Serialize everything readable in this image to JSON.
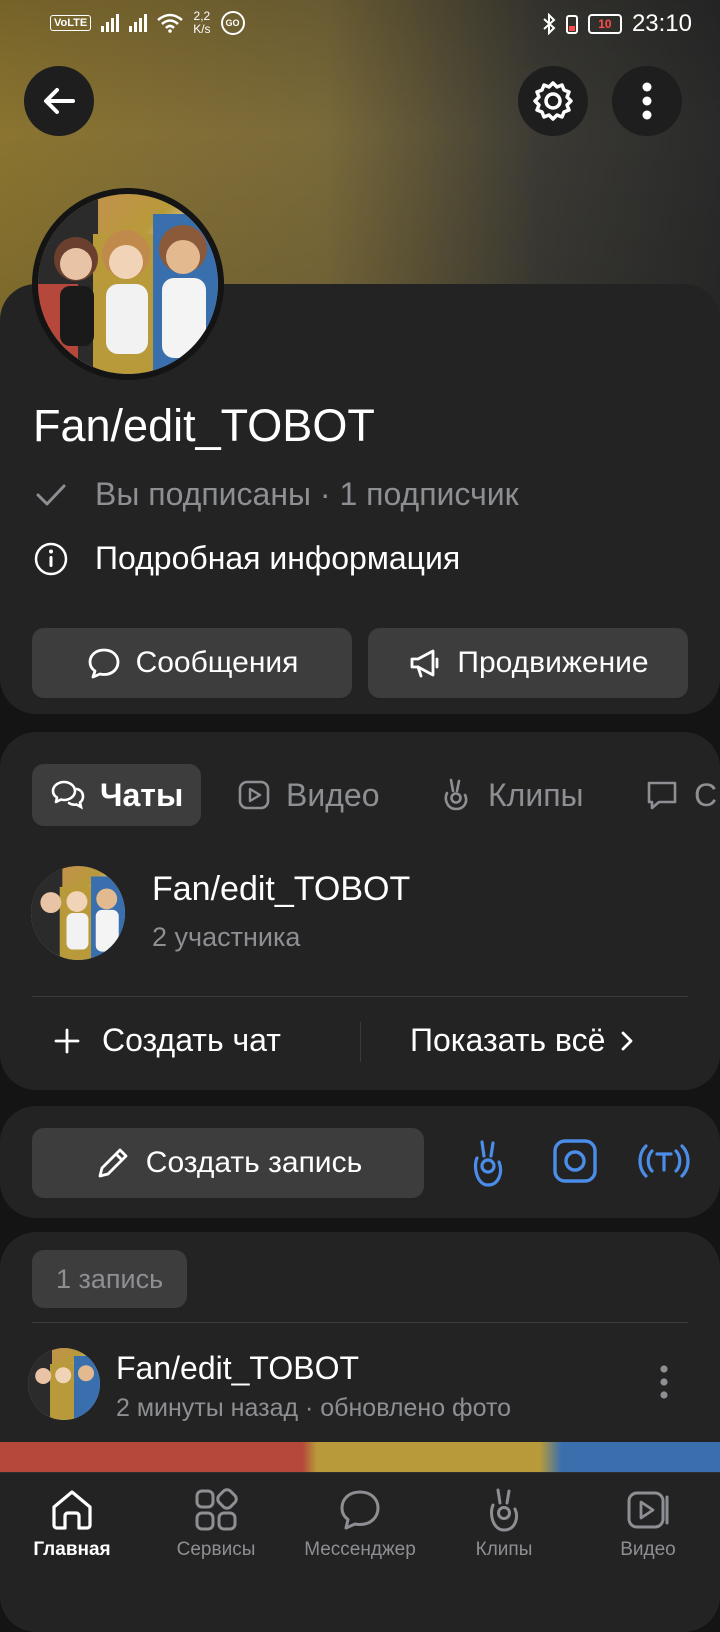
{
  "status_bar": {
    "network": "VoLTE",
    "speed_value": "2,2",
    "speed_unit": "K/s",
    "go_badge": "GO",
    "battery_level": "10",
    "time": "23:10"
  },
  "profile": {
    "name": "Fan/edit_TOBOT",
    "subscription_status": "Вы подписаны · 1 подписчик",
    "details_link": "Подробная информация",
    "messages_button": "Сообщения",
    "promotion_button": "Продвижение"
  },
  "tabs": [
    {
      "label": "Чаты",
      "active": true
    },
    {
      "label": "Видео",
      "active": false
    },
    {
      "label": "Клипы",
      "active": false
    },
    {
      "label": "С",
      "active": false
    }
  ],
  "chat": {
    "title": "Fan/edit_TOBOT",
    "members": "2 участника",
    "create_chat": "Создать чат",
    "show_all": "Показать всё"
  },
  "composer": {
    "create_post": "Создать запись"
  },
  "feed": {
    "count_badge": "1 запись",
    "post_author": "Fan/edit_TOBOT",
    "post_meta": "2 минуты назад · обновлено фото"
  },
  "bottom_nav": [
    {
      "label": "Главная",
      "icon": "home-icon",
      "active": true
    },
    {
      "label": "Сервисы",
      "icon": "services-icon",
      "active": false
    },
    {
      "label": "Мессенджер",
      "icon": "messenger-icon",
      "active": false
    },
    {
      "label": "Клипы",
      "icon": "clips-icon",
      "active": false
    },
    {
      "label": "Видео",
      "icon": "video-icon",
      "active": false
    }
  ],
  "colors": {
    "background": "#141414",
    "card": "#232324",
    "button": "#3d3d3e",
    "accent_blue": "#4b8de8",
    "muted_text": "#8d8f93"
  }
}
